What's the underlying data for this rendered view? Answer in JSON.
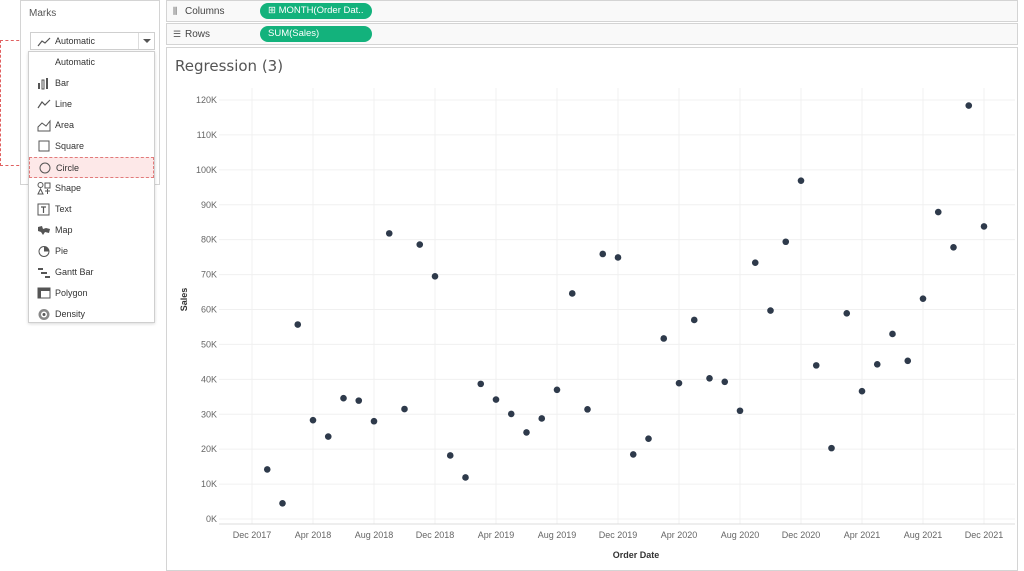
{
  "marks_card": {
    "title": "Marks",
    "selected": "Automatic",
    "menu": [
      {
        "label": "Automatic",
        "icon": "none"
      },
      {
        "label": "Bar",
        "icon": "bar-icon"
      },
      {
        "label": "Line",
        "icon": "line-icon"
      },
      {
        "label": "Area",
        "icon": "area-icon"
      },
      {
        "label": "Square",
        "icon": "square-icon"
      },
      {
        "label": "Circle",
        "icon": "circle-icon",
        "highlighted": true
      },
      {
        "label": "Shape",
        "icon": "shape-icon"
      },
      {
        "label": "Text",
        "icon": "text-icon"
      },
      {
        "label": "Map",
        "icon": "map-icon"
      },
      {
        "label": "Pie",
        "icon": "pie-icon"
      },
      {
        "label": "Gantt Bar",
        "icon": "gantt-bar-icon"
      },
      {
        "label": "Polygon",
        "icon": "polygon-icon"
      },
      {
        "label": "Density",
        "icon": "density-icon"
      }
    ]
  },
  "shelves": {
    "columns": {
      "label": "Columns",
      "pill": "⊞ MONTH(Order Dat.."
    },
    "rows": {
      "label": "Rows",
      "pill": "SUM(Sales)"
    }
  },
  "view": {
    "title": "Regression (3)"
  },
  "colors": {
    "accent_pill": "#13b27c",
    "mark": "#2e3a4b",
    "highlight": "#fde8e8"
  },
  "chart_data": {
    "type": "scatter",
    "xlabel": "Order Date",
    "ylabel": "Sales",
    "x_ticks": [
      "Dec 2017",
      "Apr 2018",
      "Aug 2018",
      "Dec 2018",
      "Apr 2019",
      "Aug 2019",
      "Dec 2019",
      "Apr 2020",
      "Aug 2020",
      "Dec 2020",
      "Apr 2021",
      "Aug 2021",
      "Dec 2021"
    ],
    "y_ticks": [
      "0K",
      "10K",
      "20K",
      "30K",
      "40K",
      "50K",
      "60K",
      "70K",
      "80K",
      "90K",
      "100K",
      "110K",
      "120K"
    ],
    "ylim": [
      0,
      120000
    ],
    "xlim": [
      "2017-11-01",
      "2022-01-01"
    ],
    "grid": true,
    "points": [
      {
        "x": "2018-01",
        "y": 14200
      },
      {
        "x": "2018-02",
        "y": 4500
      },
      {
        "x": "2018-03",
        "y": 55700
      },
      {
        "x": "2018-04",
        "y": 28300
      },
      {
        "x": "2018-05",
        "y": 23600
      },
      {
        "x": "2018-06",
        "y": 34600
      },
      {
        "x": "2018-07",
        "y": 33900
      },
      {
        "x": "2018-08",
        "y": 28000
      },
      {
        "x": "2018-09",
        "y": 81800
      },
      {
        "x": "2018-10",
        "y": 31500
      },
      {
        "x": "2018-11",
        "y": 78600
      },
      {
        "x": "2018-12",
        "y": 69500
      },
      {
        "x": "2019-01",
        "y": 18200
      },
      {
        "x": "2019-02",
        "y": 11900
      },
      {
        "x": "2019-03",
        "y": 38700
      },
      {
        "x": "2019-04",
        "y": 34200
      },
      {
        "x": "2019-05",
        "y": 30100
      },
      {
        "x": "2019-06",
        "y": 24800
      },
      {
        "x": "2019-07",
        "y": 28800
      },
      {
        "x": "2019-08",
        "y": 37000
      },
      {
        "x": "2019-09",
        "y": 64600
      },
      {
        "x": "2019-10",
        "y": 31400
      },
      {
        "x": "2019-11",
        "y": 75900
      },
      {
        "x": "2019-12",
        "y": 74900
      },
      {
        "x": "2020-01",
        "y": 18500
      },
      {
        "x": "2020-02",
        "y": 23000
      },
      {
        "x": "2020-03",
        "y": 51700
      },
      {
        "x": "2020-04",
        "y": 38900
      },
      {
        "x": "2020-05",
        "y": 57000
      },
      {
        "x": "2020-06",
        "y": 40300
      },
      {
        "x": "2020-07",
        "y": 39300
      },
      {
        "x": "2020-08",
        "y": 31000
      },
      {
        "x": "2020-09",
        "y": 73400
      },
      {
        "x": "2020-10",
        "y": 59700
      },
      {
        "x": "2020-11",
        "y": 79400
      },
      {
        "x": "2020-12",
        "y": 96900
      },
      {
        "x": "2021-01",
        "y": 44000
      },
      {
        "x": "2021-02",
        "y": 20300
      },
      {
        "x": "2021-03",
        "y": 58900
      },
      {
        "x": "2021-04",
        "y": 36600
      },
      {
        "x": "2021-05",
        "y": 44300
      },
      {
        "x": "2021-06",
        "y": 53000
      },
      {
        "x": "2021-07",
        "y": 45300
      },
      {
        "x": "2021-08",
        "y": 63100
      },
      {
        "x": "2021-09",
        "y": 87900
      },
      {
        "x": "2021-10",
        "y": 77800
      },
      {
        "x": "2021-11",
        "y": 118400
      },
      {
        "x": "2021-12",
        "y": 83800
      }
    ]
  }
}
